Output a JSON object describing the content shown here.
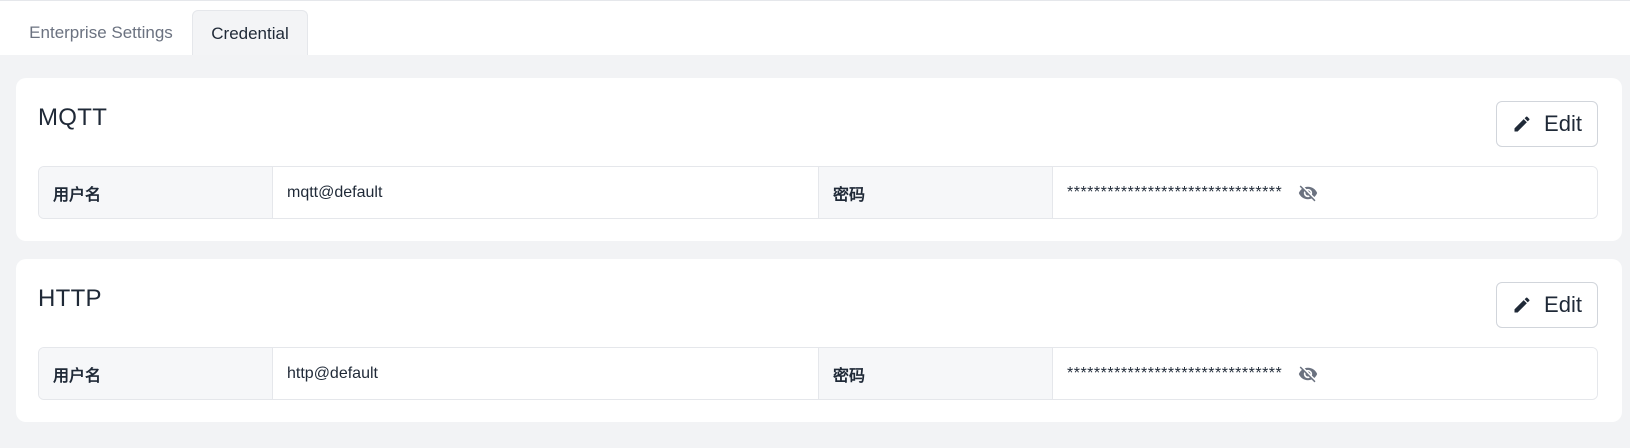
{
  "tabs": [
    {
      "label": "Enterprise Settings",
      "active": false
    },
    {
      "label": "Credential",
      "active": true
    }
  ],
  "cards": [
    {
      "title": "MQTT",
      "edit_label": "Edit",
      "username_label": "用户名",
      "username_value": "mqtt@default",
      "password_label": "密码",
      "password_value": "********************************"
    },
    {
      "title": "HTTP",
      "edit_label": "Edit",
      "username_label": "用户名",
      "username_value": "http@default",
      "password_label": "密码",
      "password_value": "********************************"
    }
  ],
  "icons": {
    "edit": "pencil-icon",
    "visibility": "eye-off-icon"
  },
  "colors": {
    "background": "#f2f3f5",
    "card": "#ffffff",
    "label_cell": "#f6f7f9",
    "border": "#e5e7eb",
    "text": "#1f2937",
    "muted_text": "#6b7280"
  }
}
